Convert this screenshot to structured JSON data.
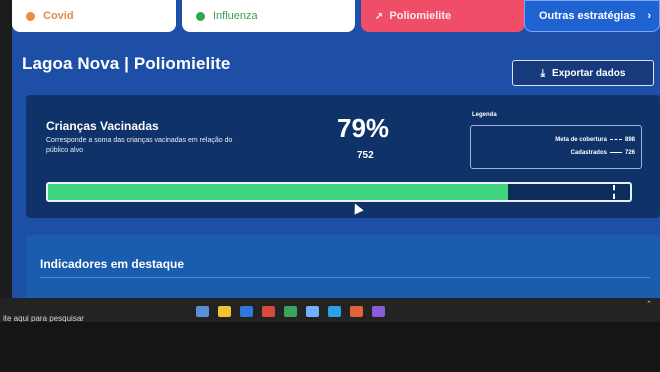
{
  "tabs": [
    {
      "label": "Covid",
      "color": "#f08b3b"
    },
    {
      "label": "Influenza",
      "color": "#2fa64b"
    },
    {
      "label": "Poliomielite",
      "color": "#ef4d68"
    },
    {
      "label": "Outras estratégias"
    }
  ],
  "page": {
    "title": "Lagoa Nova | Poliomielite",
    "export_label": "Exportar dados"
  },
  "vaccinated_card": {
    "title": "Crianças Vacinadas",
    "description": "Corresponde a soma das crianças vacinadas em relação do público alvo",
    "percent": "79%",
    "percent_value": 0.79,
    "count": "752",
    "legend_title": "Legenda",
    "legend": {
      "coverage_label": "Meta de cobertura",
      "coverage_value": "898",
      "registered_label": "Cadastrados",
      "registered_value": "726"
    },
    "target_fraction": 0.97,
    "colors": {
      "fill": "#3fd47d",
      "track": "#0c2c5c"
    }
  },
  "highlights": {
    "title": "Indicadores em destaque"
  },
  "taskbar": {
    "search_text": "ite aqui para pesquisar"
  }
}
